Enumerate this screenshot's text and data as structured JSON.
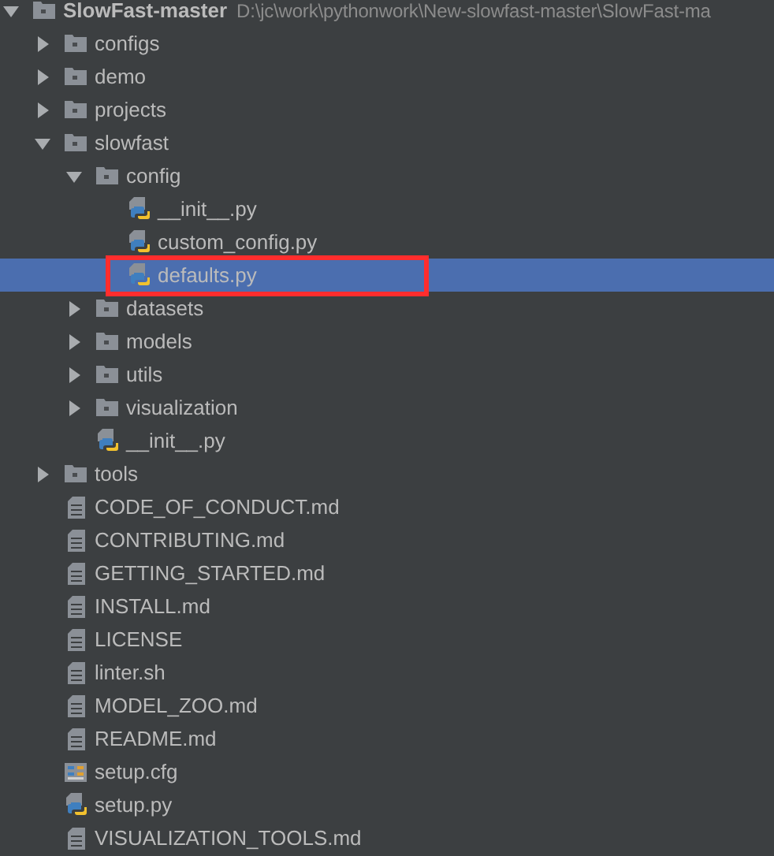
{
  "project_tree": {
    "kind": "root",
    "name": "SlowFast-master",
    "path": "D:\\jc\\work\\pythonwork\\New-slowfast-master\\SlowFast-ma",
    "expanded": true,
    "selected": false,
    "boxed": false,
    "children": [
      {
        "kind": "folder",
        "name": "configs",
        "expanded": false,
        "selected": false,
        "boxed": false
      },
      {
        "kind": "folder",
        "name": "demo",
        "expanded": false,
        "selected": false,
        "boxed": false
      },
      {
        "kind": "folder",
        "name": "projects",
        "expanded": false,
        "selected": false,
        "boxed": false
      },
      {
        "kind": "folder",
        "name": "slowfast",
        "expanded": true,
        "selected": false,
        "boxed": false,
        "children": [
          {
            "kind": "folder",
            "name": "config",
            "expanded": true,
            "selected": false,
            "boxed": false,
            "children": [
              {
                "kind": "python",
                "name": "__init__.py",
                "selected": false,
                "boxed": false
              },
              {
                "kind": "python",
                "name": "custom_config.py",
                "selected": false,
                "boxed": false
              },
              {
                "kind": "python",
                "name": "defaults.py",
                "selected": true,
                "boxed": true
              }
            ]
          },
          {
            "kind": "folder",
            "name": "datasets",
            "expanded": false,
            "selected": false,
            "boxed": false
          },
          {
            "kind": "folder",
            "name": "models",
            "expanded": false,
            "selected": false,
            "boxed": false
          },
          {
            "kind": "folder",
            "name": "utils",
            "expanded": false,
            "selected": false,
            "boxed": false
          },
          {
            "kind": "folder",
            "name": "visualization",
            "expanded": false,
            "selected": false,
            "boxed": false
          },
          {
            "kind": "python",
            "name": "__init__.py",
            "selected": false,
            "boxed": false
          }
        ]
      },
      {
        "kind": "folder",
        "name": "tools",
        "expanded": false,
        "selected": false,
        "boxed": false
      },
      {
        "kind": "text",
        "name": "CODE_OF_CONDUCT.md",
        "selected": false,
        "boxed": false
      },
      {
        "kind": "text",
        "name": "CONTRIBUTING.md",
        "selected": false,
        "boxed": false
      },
      {
        "kind": "text",
        "name": "GETTING_STARTED.md",
        "selected": false,
        "boxed": false
      },
      {
        "kind": "text",
        "name": "INSTALL.md",
        "selected": false,
        "boxed": false
      },
      {
        "kind": "text",
        "name": "LICENSE",
        "selected": false,
        "boxed": false
      },
      {
        "kind": "text",
        "name": "linter.sh",
        "selected": false,
        "boxed": false
      },
      {
        "kind": "text",
        "name": "MODEL_ZOO.md",
        "selected": false,
        "boxed": false
      },
      {
        "kind": "text",
        "name": "README.md",
        "selected": false,
        "boxed": false
      },
      {
        "kind": "config",
        "name": "setup.cfg",
        "selected": false,
        "boxed": false
      },
      {
        "kind": "python",
        "name": "setup.py",
        "selected": false,
        "boxed": false
      },
      {
        "kind": "text",
        "name": "VISUALIZATION_TOOLS.md",
        "selected": false,
        "boxed": false
      }
    ]
  }
}
